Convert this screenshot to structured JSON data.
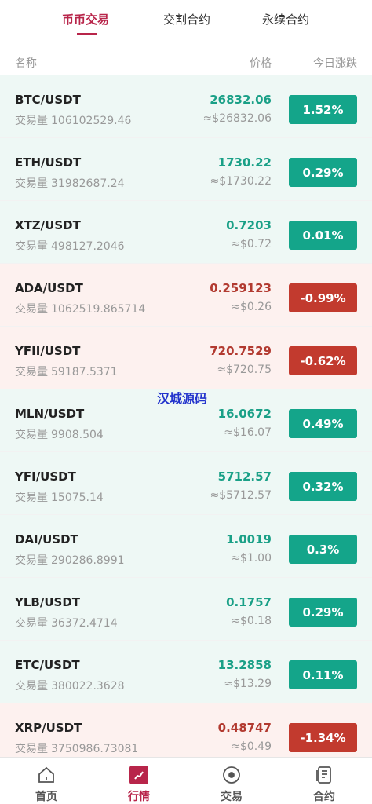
{
  "tabs": [
    {
      "label": "币币交易",
      "active": true
    },
    {
      "label": "交割合约",
      "active": false
    },
    {
      "label": "永续合约",
      "active": false
    }
  ],
  "columns": {
    "name": "名称",
    "price": "价格",
    "change": "今日涨跌"
  },
  "volume_label": "交易量",
  "rows": [
    {
      "pair": "BTC/USDT",
      "volume": "106102529.46",
      "price": "26832.06",
      "usd": "≈$26832.06",
      "change": "1.52%",
      "trend": "up"
    },
    {
      "pair": "ETH/USDT",
      "volume": "31982687.24",
      "price": "1730.22",
      "usd": "≈$1730.22",
      "change": "0.29%",
      "trend": "up"
    },
    {
      "pair": "XTZ/USDT",
      "volume": "498127.2046",
      "price": "0.7203",
      "usd": "≈$0.72",
      "change": "0.01%",
      "trend": "up"
    },
    {
      "pair": "ADA/USDT",
      "volume": "1062519.865714",
      "price": "0.259123",
      "usd": "≈$0.26",
      "change": "-0.99%",
      "trend": "down"
    },
    {
      "pair": "YFII/USDT",
      "volume": "59187.5371",
      "price": "720.7529",
      "usd": "≈$720.75",
      "change": "-0.62%",
      "trend": "down"
    },
    {
      "pair": "MLN/USDT",
      "volume": "9908.504",
      "price": "16.0672",
      "usd": "≈$16.07",
      "change": "0.49%",
      "trend": "up"
    },
    {
      "pair": "YFI/USDT",
      "volume": "15075.14",
      "price": "5712.57",
      "usd": "≈$5712.57",
      "change": "0.32%",
      "trend": "up"
    },
    {
      "pair": "DAI/USDT",
      "volume": "290286.8991",
      "price": "1.0019",
      "usd": "≈$1.00",
      "change": "0.3%",
      "trend": "up"
    },
    {
      "pair": "YLB/USDT",
      "volume": "36372.4714",
      "price": "0.1757",
      "usd": "≈$0.18",
      "change": "0.29%",
      "trend": "up"
    },
    {
      "pair": "ETC/USDT",
      "volume": "380022.3628",
      "price": "13.2858",
      "usd": "≈$13.29",
      "change": "0.11%",
      "trend": "up"
    },
    {
      "pair": "XRP/USDT",
      "volume": "3750986.73081",
      "price": "0.48747",
      "usd": "≈$0.49",
      "change": "-1.34%",
      "trend": "down"
    }
  ],
  "watermark": "汉城源码",
  "nav": [
    {
      "label": "首页",
      "icon": "home-icon",
      "active": false
    },
    {
      "label": "行情",
      "icon": "market-icon",
      "active": true
    },
    {
      "label": "交易",
      "icon": "trade-icon",
      "active": false
    },
    {
      "label": "合约",
      "icon": "contract-icon",
      "active": false
    }
  ],
  "colors": {
    "accent": "#b8254a",
    "up": "#14a58a",
    "down": "#c23a2e"
  }
}
